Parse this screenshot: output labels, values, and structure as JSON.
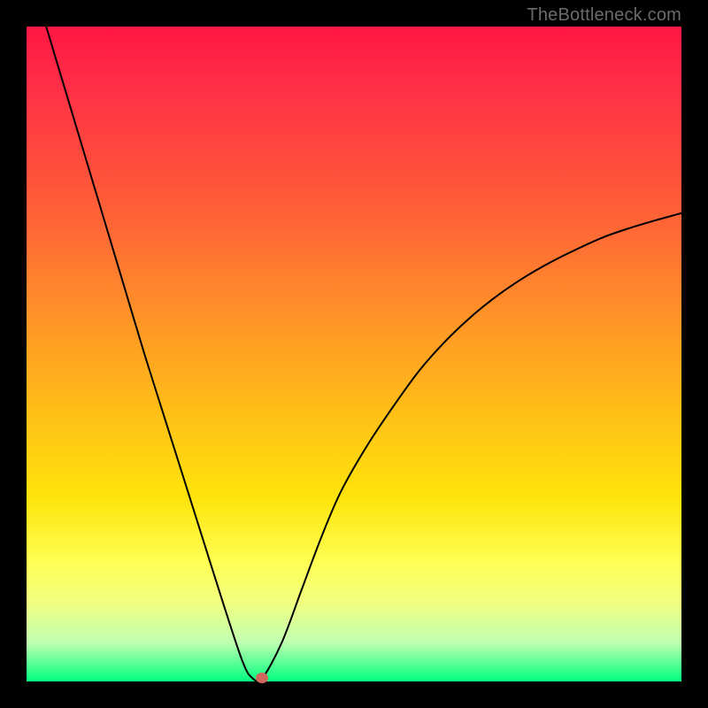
{
  "attribution": "TheBottleneck.com",
  "chart_data": {
    "type": "line",
    "title": "",
    "xlabel": "",
    "ylabel": "",
    "xlim": [
      0,
      100
    ],
    "ylim": [
      0,
      100
    ],
    "x": [
      3,
      6,
      9,
      12,
      15,
      18,
      21,
      24,
      27,
      30,
      33,
      34.5,
      36,
      39,
      42,
      45,
      48,
      52,
      56,
      60,
      64,
      68,
      72,
      76,
      80,
      84,
      88,
      92,
      96,
      100
    ],
    "values": [
      100,
      90,
      80,
      70,
      60,
      50,
      40.5,
      31,
      21.5,
      12,
      3,
      0.5,
      0.5,
      6,
      14,
      22,
      29,
      36,
      42,
      47.5,
      52,
      55.8,
      59,
      61.7,
      64,
      66,
      67.8,
      69.2,
      70.4,
      71.5
    ],
    "marker": {
      "x": 36,
      "y": 0.5
    },
    "gradient_stops": [
      {
        "pos": 0,
        "color": "#ff1744"
      },
      {
        "pos": 50,
        "color": "#ffc400"
      },
      {
        "pos": 80,
        "color": "#ffff55"
      },
      {
        "pos": 100,
        "color": "#00ff7f"
      }
    ]
  }
}
